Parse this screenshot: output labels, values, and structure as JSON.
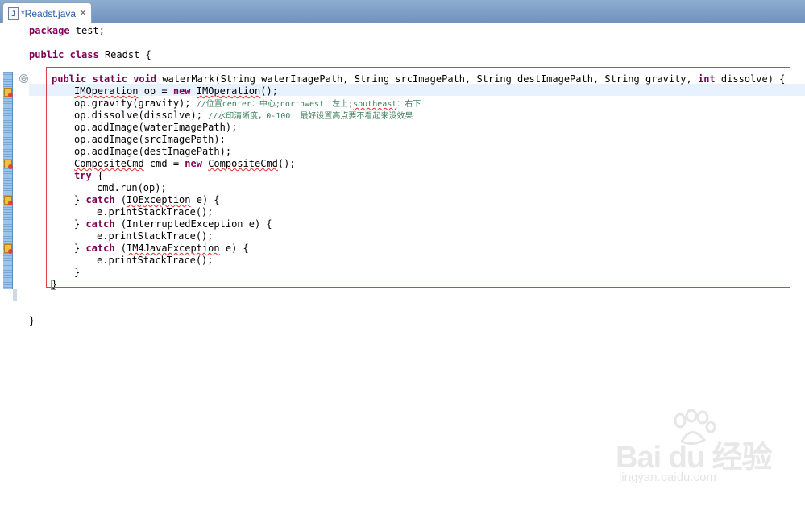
{
  "tab": {
    "title": "*Readst.java",
    "close": "✕",
    "file_icon": "J"
  },
  "gutter": {
    "fold_symbol": "⊖"
  },
  "code": {
    "l1": [
      "package",
      " test;"
    ],
    "l3": [
      "public",
      " ",
      "class",
      " Readst {"
    ],
    "l5": [
      "public",
      " ",
      "static",
      " ",
      "void",
      " waterMark(String waterImagePath, String srcImagePath, String destImagePath, String gravity, ",
      "int",
      " dissolve) {"
    ],
    "l6": [
      "IMOperation",
      " op = ",
      "new",
      " ",
      "IMOperation",
      "();"
    ],
    "l7": [
      "op.gravity(gravity); ",
      "//位置center：中心;northwest：左上;",
      "southeast",
      "：右下"
    ],
    "l8": [
      "op.dissolve(dissolve); ",
      "//水印清晰度，0-100  最好设置高点要不看起来没效果"
    ],
    "l9": "op.addImage(waterImagePath);",
    "l10": "op.addImage(srcImagePath);",
    "l11": "op.addImage(destImagePath);",
    "l12": [
      "CompositeCmd",
      " cmd = ",
      "new",
      " ",
      "CompositeCmd",
      "();"
    ],
    "l13": [
      "try",
      " {"
    ],
    "l14": "cmd.run(op);",
    "l15": [
      "} ",
      "catch",
      " (",
      "IOException",
      " e) {"
    ],
    "l16": "e.printStackTrace();",
    "l17": [
      "} ",
      "catch",
      " (InterruptedException e) {"
    ],
    "l18": "e.printStackTrace();",
    "l19": [
      "} ",
      "catch",
      " (",
      "IM4JavaException",
      " e) {"
    ],
    "l20": "e.printStackTrace();",
    "l21": "}",
    "l22": "}",
    "l26": "}"
  },
  "watermark": {
    "brand": "Bai  du 经验",
    "url": "jingyan.baidu.com"
  },
  "colors": {
    "keyword": "#7f0055",
    "comment": "#3f7f5f",
    "highlight_box": "#d9404a"
  }
}
